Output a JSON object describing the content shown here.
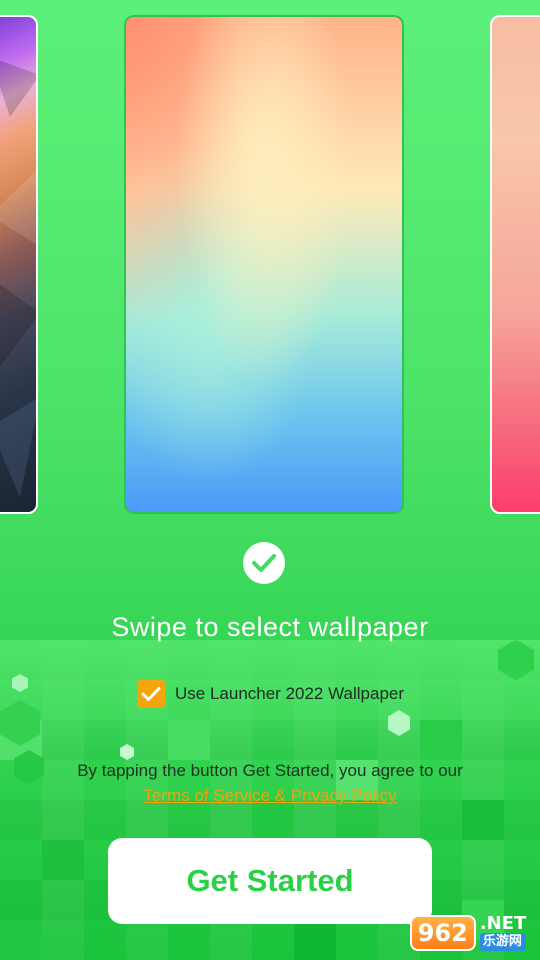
{
  "wallpapers": [
    {
      "name": "polygon-dark"
    },
    {
      "name": "pastel-gradient",
      "selected": true
    },
    {
      "name": "pink-gradient"
    }
  ],
  "selection": {
    "title": "Swipe to select wallpaper"
  },
  "option": {
    "checked": true,
    "label": "Use Launcher 2022 Wallpaper"
  },
  "legal": {
    "text": "By tapping the button Get Started, you agree to our",
    "link": "Terms of Service & Privacy Policy"
  },
  "cta": {
    "label": "Get Started"
  },
  "watermark": {
    "number": "962",
    "suffix": ".NET",
    "cn": "乐游网"
  },
  "colors": {
    "accent": "#2bd145",
    "checkbox": "#f4a50b",
    "link": "#f2a20b",
    "background": "#4ee46a"
  }
}
